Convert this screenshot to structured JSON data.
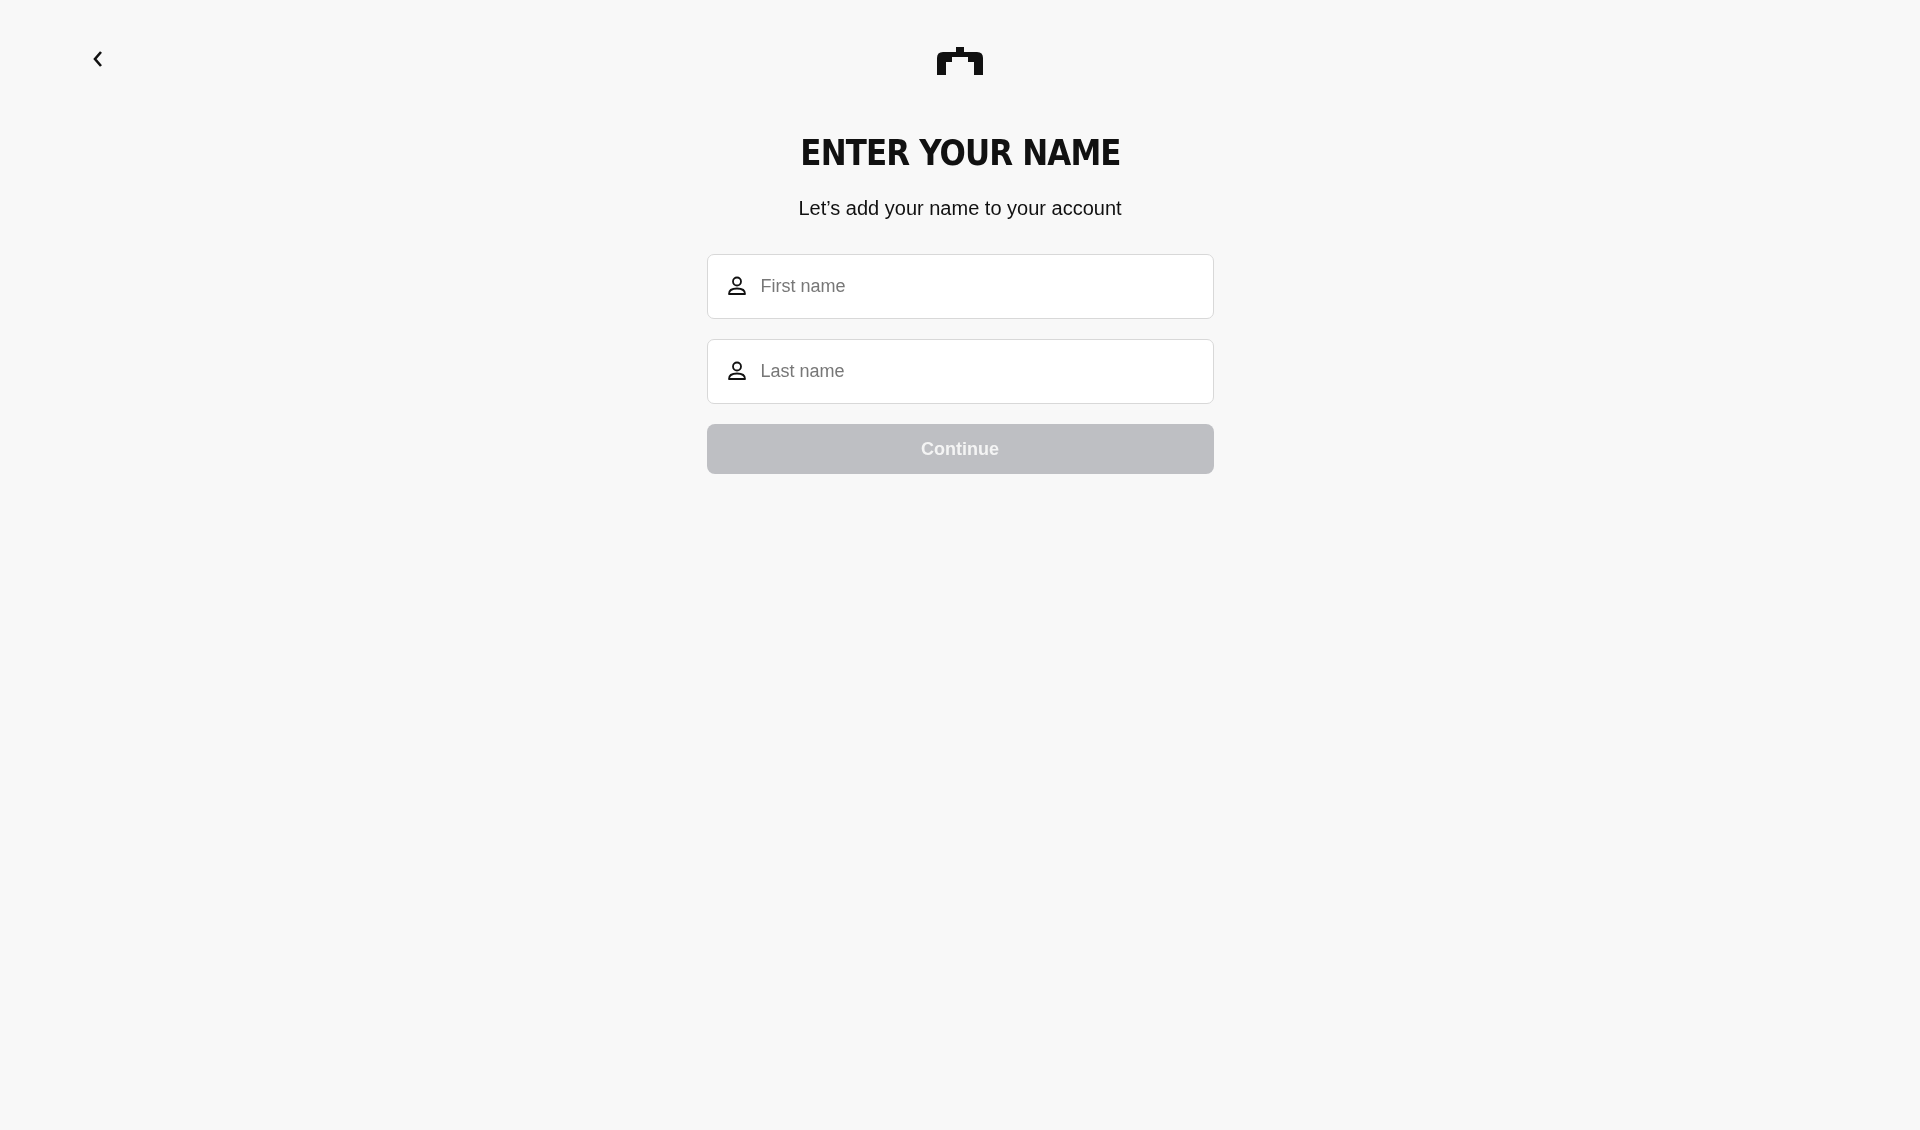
{
  "title": "ENTER YOUR NAME",
  "subtitle": "Let’s add your name to your account",
  "fields": [
    {
      "placeholder": "First name"
    },
    {
      "placeholder": "Last name"
    }
  ],
  "continue_button": {
    "label": "Continue",
    "disabled": true
  }
}
